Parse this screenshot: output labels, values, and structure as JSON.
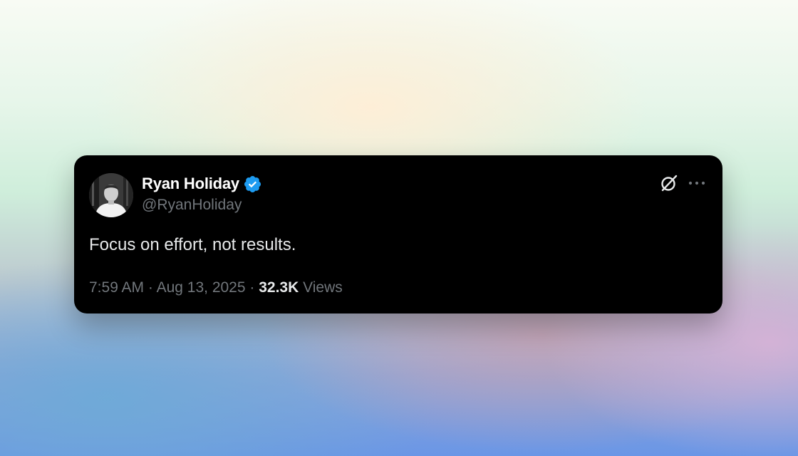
{
  "tweet": {
    "author_name": "Ryan Holiday",
    "handle": "@RyanHoliday",
    "verified": true,
    "text": "Focus on effort, not results.",
    "time": "7:59 AM",
    "separator": "·",
    "date": "Aug 13, 2025",
    "views_count": "32.3K",
    "views_label": "Views"
  },
  "icons": {
    "verified": "verified-badge-icon",
    "grok": "grok-icon",
    "more": "more-options-icon"
  },
  "colors": {
    "card_background": "#000000",
    "name": "#ffffff",
    "secondary_text": "#71767b",
    "verified_blue": "#1d9bf0"
  }
}
